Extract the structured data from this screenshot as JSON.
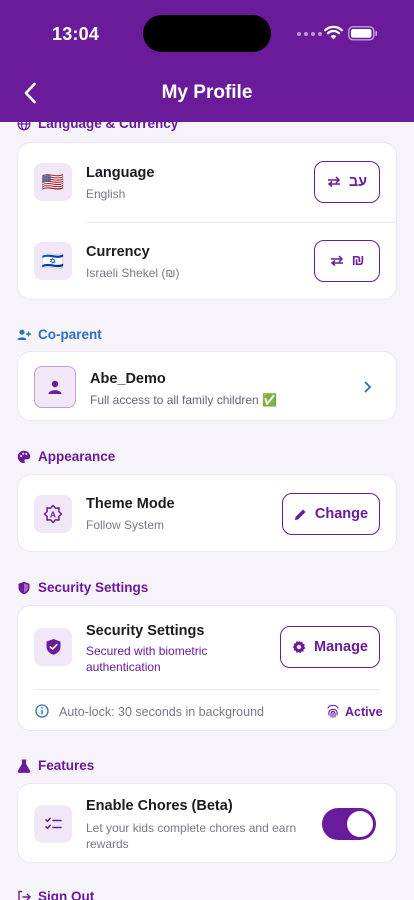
{
  "status_bar": {
    "time": "13:04"
  },
  "header": {
    "title": "My Profile"
  },
  "sections": {
    "language_currency": {
      "title": "Language & Currency",
      "language": {
        "title": "Language",
        "value": "English",
        "flag": "🇺🇸",
        "button_label": "עב"
      },
      "currency": {
        "title": "Currency",
        "value": "Israeli Shekel (₪)",
        "flag": "🇮🇱",
        "button_label": "₪"
      }
    },
    "coparent": {
      "title": "Co-parent",
      "name": "Abe_Demo",
      "description": "Full access to all family children ✅"
    },
    "appearance": {
      "title": "Appearance",
      "theme_title": "Theme Mode",
      "theme_value": "Follow System",
      "button_label": "Change"
    },
    "security": {
      "title": "Security Settings",
      "card_title": "Security Settings",
      "status": "Secured with biometric authentication",
      "button_label": "Manage",
      "autolock": "Auto-lock: 30 seconds in background",
      "biometric_status": "Active"
    },
    "features": {
      "title": "Features",
      "chores_title": "Enable Chores (Beta)",
      "chores_desc": "Let your kids complete chores and earn rewards",
      "chores_enabled": true
    },
    "signout": {
      "title": "Sign Out"
    }
  },
  "colors": {
    "primary": "#6a1b9a",
    "link_blue": "#2d6fbf",
    "background": "#f6f3fb"
  }
}
